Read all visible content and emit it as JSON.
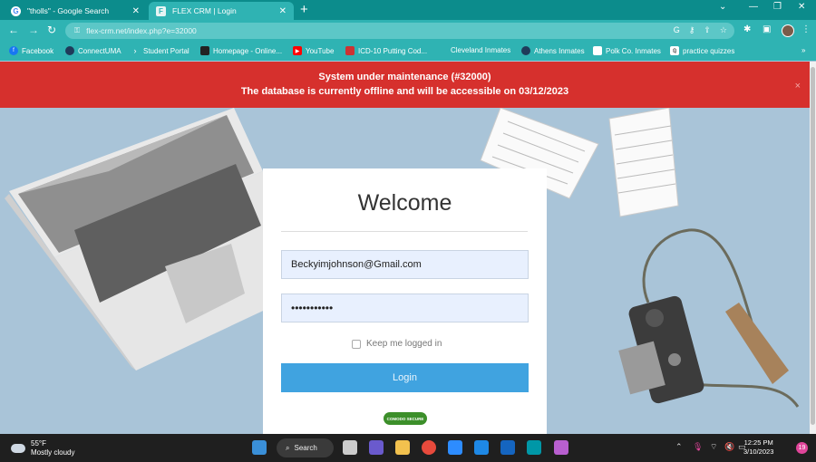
{
  "browser": {
    "tabs": [
      {
        "label": "\"tholls\" - Google Search",
        "favicon": "G",
        "active": false
      },
      {
        "label": "FLEX CRM | Login",
        "favicon": "F",
        "active": true
      }
    ],
    "new_tab": "+",
    "url": "flex-crm.net/index.php?e=32000",
    "bookmarks": [
      "Facebook",
      "ConnectUMA",
      "Student Portal",
      "Homepage - Online...",
      "YouTube",
      "ICD-10 Putting Cod...",
      "Cleveland Inmates",
      "Athens Inmates",
      "Polk Co. Inmates",
      "practice quizzes"
    ],
    "more_bookmarks": "»"
  },
  "banner": {
    "line1": "System under maintenance (#32000)",
    "line2": "The database is currently offline and will be accessible on 03/12/2023",
    "close": "×"
  },
  "login": {
    "title": "Welcome",
    "email_value": "Beckyimjohnson@Gmail.com",
    "password_value": "•••••••••••",
    "remember_label": "Keep me logged in",
    "remember_checked": false,
    "button_label": "Login",
    "seal_text": "COMODO SECURE"
  },
  "taskbar": {
    "temperature": "55°F",
    "condition": "Mostly cloudy",
    "search_label": "Search",
    "time": "12:25 PM",
    "date": "3/10/2023",
    "notification_count": "19"
  },
  "colors": {
    "banner_bg": "#d6302d",
    "chrome_teal": "#2fb3b3",
    "login_button": "#40a3e0",
    "background": "#a9c4d8"
  }
}
